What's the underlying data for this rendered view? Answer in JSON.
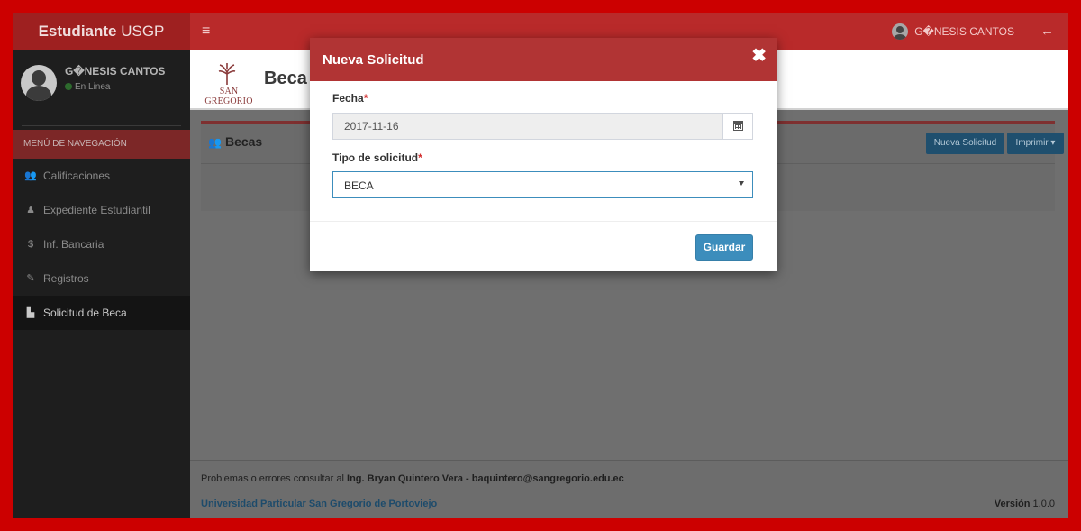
{
  "app": {
    "brand_bold": "Estudiante",
    "brand_rest": " USGP",
    "toggle_icon": "≡",
    "user_name": "G�NESIS CANTOS",
    "back_icon": "←"
  },
  "sidebar": {
    "user_name": "G�NESIS CANTOS",
    "user_status": "En Linea",
    "nav_header": "MENÚ DE NAVEGACIÓN",
    "items": [
      {
        "label": "Calificaciones",
        "icon": "users-icon",
        "glyph": "👥"
      },
      {
        "label": "Expediente Estudiantil",
        "icon": "user-icon",
        "glyph": "♟"
      },
      {
        "label": "Inf. Bancaria",
        "icon": "dollar-icon",
        "glyph": "$"
      },
      {
        "label": "Registros",
        "icon": "edit-icon",
        "glyph": "✎"
      },
      {
        "label": "Solicitud de Beca",
        "icon": "file-icon",
        "glyph": "▙"
      }
    ]
  },
  "content": {
    "logo_text": "SAN GREGORIO",
    "page_title": "Beca",
    "box_title": "Becas",
    "box_icon": "users-icon",
    "new_request_label": "Nueva Solicitud",
    "print_label": "Imprimir ▾"
  },
  "footer": {
    "problems_text": "Problemas o errores consultar al ",
    "contact": "Ing. Bryan Quintero Vera - baquintero@sangregorio.edu.ec",
    "university": "Universidad Particular San Gregorio de Portoviejo",
    "version_label": "Versión",
    "version_number": " 1.0.0"
  },
  "modal": {
    "title": "Nueva Solicitud",
    "close_icon": "✖",
    "fecha_label": "Fecha",
    "fecha_value": "2017-11-16",
    "tipo_label": "Tipo de solicitud",
    "tipo_value": "BECA",
    "required_mark": "*",
    "save_label": "Guardar"
  },
  "colors": {
    "frame": "#cc0000",
    "header": "#b92a2a",
    "modal_header": "#b13434",
    "primary_button": "#3c8dbc"
  }
}
